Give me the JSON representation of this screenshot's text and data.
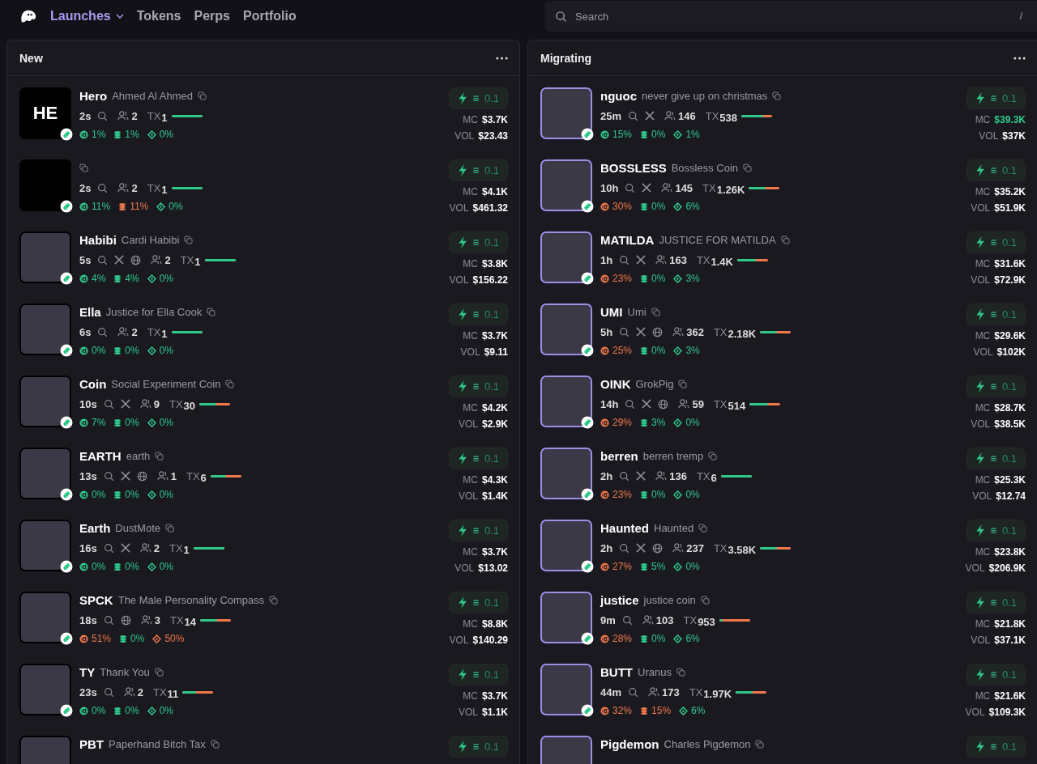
{
  "nav": {
    "items": [
      {
        "label": "Launches",
        "selected": true,
        "dropdown": true
      },
      {
        "label": "Tokens",
        "selected": false,
        "dropdown": false
      },
      {
        "label": "Perps",
        "selected": false,
        "dropdown": false
      },
      {
        "label": "Portfolio",
        "selected": false,
        "dropdown": false
      }
    ]
  },
  "search": {
    "placeholder": "Search",
    "shortcut": "/"
  },
  "columns": [
    {
      "title": "New",
      "tokens": [
        {
          "ticker": "Hero",
          "name": "Ahmed Al Ahmed",
          "avatar_text": "HE",
          "ring": false,
          "partial": false,
          "age": "2s",
          "links": [
            {
              "kind": "search"
            }
          ],
          "holders": "2",
          "tx_label": "TX",
          "tx": "1",
          "level": 1,
          "top10": {
            "value": "1%",
            "warn": false
          },
          "dev": {
            "value": "1%",
            "warn": false
          },
          "snipers": {
            "value": "0%",
            "warn": false
          },
          "mc_label": "MC",
          "mc": "$3.7K",
          "mc_up": false,
          "vol_label": "VOL",
          "vol": "$23.43",
          "quick_buy": "0.1"
        },
        {
          "avatar_blank": true,
          "ring": false,
          "partial": false,
          "age": "2s",
          "links": [
            {
              "kind": "search"
            }
          ],
          "holders": "2",
          "tx_label": "TX",
          "tx": "1",
          "level": 1,
          "top10": {
            "value": "11%",
            "warn": false
          },
          "dev": {
            "value": "11%",
            "warn": true
          },
          "snipers": {
            "value": "0%",
            "warn": false
          },
          "mc_label": "MC",
          "mc": "$4.1K",
          "mc_up": false,
          "vol_label": "VOL",
          "vol": "$461.32",
          "quick_buy": "0.1"
        },
        {
          "ticker": "Habibi",
          "name": "Cardi Habibi",
          "ring": false,
          "partial": false,
          "age": "5s",
          "links": [
            {
              "kind": "search"
            },
            {
              "kind": "x"
            },
            {
              "kind": "web"
            }
          ],
          "holders": "2",
          "tx_label": "TX",
          "tx": "1",
          "level": 1,
          "top10": {
            "value": "4%",
            "warn": false
          },
          "dev": {
            "value": "4%",
            "warn": false
          },
          "snipers": {
            "value": "0%",
            "warn": false
          },
          "mc_label": "MC",
          "mc": "$3.8K",
          "mc_up": false,
          "vol_label": "VOL",
          "vol": "$156.22",
          "quick_buy": "0.1"
        },
        {
          "ticker": "Ella",
          "name": "Justice for Ella Cook",
          "ring": false,
          "partial": false,
          "age": "6s",
          "links": [
            {
              "kind": "search"
            }
          ],
          "holders": "2",
          "tx_label": "TX",
          "tx": "1",
          "level": 1,
          "top10": {
            "value": "0%",
            "warn": false
          },
          "dev": {
            "value": "0%",
            "warn": false
          },
          "snipers": {
            "value": "0%",
            "warn": false
          },
          "mc_label": "MC",
          "mc": "$3.7K",
          "mc_up": false,
          "vol_label": "VOL",
          "vol": "$9.11",
          "quick_buy": "0.1"
        },
        {
          "ticker": "Coin",
          "name": "Social Experiment Coin",
          "ring": false,
          "partial": false,
          "age": "10s",
          "links": [
            {
              "kind": "search"
            },
            {
              "kind": "x"
            }
          ],
          "holders": "9",
          "tx_label": "TX",
          "tx": "30",
          "level": 0.55,
          "top10": {
            "value": "7%",
            "warn": false
          },
          "dev": {
            "value": "0%",
            "warn": false
          },
          "snipers": {
            "value": "0%",
            "warn": false
          },
          "mc_label": "MC",
          "mc": "$4.2K",
          "mc_up": false,
          "vol_label": "VOL",
          "vol": "$2.9K",
          "quick_buy": "0.1"
        },
        {
          "ticker": "EARTH",
          "name": "earth",
          "ring": false,
          "partial": false,
          "age": "13s",
          "links": [
            {
              "kind": "search"
            },
            {
              "kind": "x"
            },
            {
              "kind": "web"
            }
          ],
          "holders": "1",
          "tx_label": "TX",
          "tx": "6",
          "level": 0.5,
          "top10": {
            "value": "0%",
            "warn": false
          },
          "dev": {
            "value": "0%",
            "warn": false
          },
          "snipers": {
            "value": "0%",
            "warn": false
          },
          "mc_label": "MC",
          "mc": "$4.3K",
          "mc_up": false,
          "vol_label": "VOL",
          "vol": "$1.4K",
          "quick_buy": "0.1"
        },
        {
          "ticker": "Earth",
          "name": "DustMote",
          "ring": false,
          "partial": false,
          "age": "16s",
          "links": [
            {
              "kind": "search"
            },
            {
              "kind": "x"
            }
          ],
          "holders": "2",
          "tx_label": "TX",
          "tx": "1",
          "level": 1,
          "top10": {
            "value": "0%",
            "warn": false
          },
          "dev": {
            "value": "0%",
            "warn": false
          },
          "snipers": {
            "value": "0%",
            "warn": false
          },
          "mc_label": "MC",
          "mc": "$3.7K",
          "mc_up": false,
          "vol_label": "VOL",
          "vol": "$13.02",
          "quick_buy": "0.1"
        },
        {
          "ticker": "SPCK",
          "name": "The Male Personality Compass",
          "ring": false,
          "partial": false,
          "age": "18s",
          "links": [
            {
              "kind": "search"
            },
            {
              "kind": "web"
            }
          ],
          "holders": "3",
          "tx_label": "TX",
          "tx": "14",
          "level": 0.55,
          "top10": {
            "value": "51%",
            "warn": true
          },
          "dev": {
            "value": "0%",
            "warn": false
          },
          "snipers": {
            "value": "50%",
            "warn": true
          },
          "mc_label": "MC",
          "mc": "$8.8K",
          "mc_up": false,
          "vol_label": "VOL",
          "vol": "$140.29",
          "quick_buy": "0.1"
        },
        {
          "ticker": "TY",
          "name": "Thank You",
          "ring": false,
          "partial": false,
          "age": "23s",
          "links": [
            {
              "kind": "search"
            }
          ],
          "holders": "2",
          "tx_label": "TX",
          "tx": "11",
          "level": 0.45,
          "top10": {
            "value": "0%",
            "warn": false
          },
          "dev": {
            "value": "0%",
            "warn": false
          },
          "snipers": {
            "value": "0%",
            "warn": false
          },
          "mc_label": "MC",
          "mc": "$3.7K",
          "mc_up": false,
          "vol_label": "VOL",
          "vol": "$1.1K",
          "quick_buy": "0.1"
        },
        {
          "ticker": "PBT",
          "name": "Paperhand Bitch Tax",
          "ring": false,
          "partial": true,
          "quick_buy": "0.1"
        }
      ]
    },
    {
      "title": "Migrating",
      "tokens": [
        {
          "ticker": "nguoc",
          "name": "never give up on christmas",
          "ring": true,
          "partial": false,
          "age": "25m",
          "links": [
            {
              "kind": "search"
            },
            {
              "kind": "x"
            }
          ],
          "holders": "146",
          "tx_label": "TX",
          "tx": "538",
          "level": 0.7,
          "top10": {
            "value": "15%",
            "warn": false
          },
          "dev": {
            "value": "0%",
            "warn": false
          },
          "snipers": {
            "value": "1%",
            "warn": false
          },
          "mc_label": "MC",
          "mc": "$39.3K",
          "mc_up": true,
          "vol_label": "VOL",
          "vol": "$37K",
          "quick_buy": "0.1"
        },
        {
          "ticker": "BOSSLESS",
          "name": "Bossless Coin",
          "ring": true,
          "partial": false,
          "age": "10h",
          "links": [
            {
              "kind": "search"
            },
            {
              "kind": "x"
            }
          ],
          "holders": "145",
          "tx_label": "TX",
          "tx": "1.26K",
          "level": 0.55,
          "top10": {
            "value": "30%",
            "warn": true
          },
          "dev": {
            "value": "0%",
            "warn": false
          },
          "snipers": {
            "value": "6%",
            "warn": false
          },
          "mc_label": "MC",
          "mc": "$35.2K",
          "mc_up": false,
          "vol_label": "VOL",
          "vol": "$51.9K",
          "quick_buy": "0.1"
        },
        {
          "ticker": "MATILDA",
          "name": "JUSTICE FOR MATILDA",
          "ring": true,
          "partial": false,
          "age": "1h",
          "links": [
            {
              "kind": "search"
            },
            {
              "kind": "x"
            }
          ],
          "holders": "163",
          "tx_label": "TX",
          "tx": "1.4K",
          "level": 0.6,
          "top10": {
            "value": "23%",
            "warn": true
          },
          "dev": {
            "value": "0%",
            "warn": false
          },
          "snipers": {
            "value": "3%",
            "warn": false
          },
          "mc_label": "MC",
          "mc": "$31.6K",
          "mc_up": false,
          "vol_label": "VOL",
          "vol": "$72.9K",
          "quick_buy": "0.1"
        },
        {
          "ticker": "UMI",
          "name": "Umi",
          "ring": true,
          "partial": false,
          "age": "5h",
          "links": [
            {
              "kind": "search"
            },
            {
              "kind": "x"
            },
            {
              "kind": "web"
            }
          ],
          "holders": "362",
          "tx_label": "TX",
          "tx": "2.18K",
          "level": 0.55,
          "top10": {
            "value": "25%",
            "warn": true
          },
          "dev": {
            "value": "0%",
            "warn": false
          },
          "snipers": {
            "value": "3%",
            "warn": false
          },
          "mc_label": "MC",
          "mc": "$29.6K",
          "mc_up": false,
          "vol_label": "VOL",
          "vol": "$102K",
          "quick_buy": "0.1"
        },
        {
          "ticker": "OINK",
          "name": "GrokPig",
          "ring": true,
          "partial": false,
          "age": "14h",
          "links": [
            {
              "kind": "search"
            },
            {
              "kind": "x"
            },
            {
              "kind": "web"
            }
          ],
          "holders": "59",
          "tx_label": "TX",
          "tx": "514",
          "level": 0.6,
          "top10": {
            "value": "29%",
            "warn": true
          },
          "dev": {
            "value": "3%",
            "warn": false
          },
          "snipers": {
            "value": "0%",
            "warn": false
          },
          "mc_label": "MC",
          "mc": "$28.7K",
          "mc_up": false,
          "vol_label": "VOL",
          "vol": "$38.5K",
          "quick_buy": "0.1"
        },
        {
          "ticker": "berren",
          "name": "berren tremp",
          "ring": true,
          "partial": false,
          "age": "2h",
          "links": [
            {
              "kind": "search"
            },
            {
              "kind": "x"
            }
          ],
          "holders": "136",
          "tx_label": "TX",
          "tx": "6",
          "level": 1,
          "top10": {
            "value": "23%",
            "warn": true
          },
          "dev": {
            "value": "0%",
            "warn": false
          },
          "snipers": {
            "value": "0%",
            "warn": false
          },
          "mc_label": "MC",
          "mc": "$25.3K",
          "mc_up": false,
          "vol_label": "VOL",
          "vol": "$12.74",
          "quick_buy": "0.1"
        },
        {
          "ticker": "Haunted",
          "name": "Haunted",
          "ring": true,
          "partial": false,
          "age": "2h",
          "links": [
            {
              "kind": "search"
            },
            {
              "kind": "x"
            },
            {
              "kind": "web"
            }
          ],
          "holders": "237",
          "tx_label": "TX",
          "tx": "3.58K",
          "level": 0.55,
          "top10": {
            "value": "27%",
            "warn": true
          },
          "dev": {
            "value": "5%",
            "warn": false
          },
          "snipers": {
            "value": "0%",
            "warn": false
          },
          "mc_label": "MC",
          "mc": "$23.8K",
          "mc_up": false,
          "vol_label": "VOL",
          "vol": "$206.9K",
          "quick_buy": "0.1"
        },
        {
          "ticker": "justice",
          "name": "justice coin",
          "ring": true,
          "partial": false,
          "age": "9m",
          "links": [
            {
              "kind": "search"
            }
          ],
          "holders": "103",
          "tx_label": "TX",
          "tx": "953",
          "level": 0.1,
          "top10": {
            "value": "28%",
            "warn": true
          },
          "dev": {
            "value": "0%",
            "warn": false
          },
          "snipers": {
            "value": "6%",
            "warn": false
          },
          "mc_label": "MC",
          "mc": "$21.8K",
          "mc_up": false,
          "vol_label": "VOL",
          "vol": "$37.1K",
          "quick_buy": "0.1"
        },
        {
          "ticker": "BUTT",
          "name": "Uranus",
          "ring": true,
          "partial": false,
          "age": "44m",
          "links": [
            {
              "kind": "search"
            }
          ],
          "holders": "173",
          "tx_label": "TX",
          "tx": "1.97K",
          "level": 0.55,
          "top10": {
            "value": "32%",
            "warn": true
          },
          "dev": {
            "value": "15%",
            "warn": true
          },
          "snipers": {
            "value": "6%",
            "warn": false
          },
          "mc_label": "MC",
          "mc": "$21.6K",
          "mc_up": false,
          "vol_label": "VOL",
          "vol": "$109.3K",
          "quick_buy": "0.1"
        },
        {
          "ticker": "Pigdemon",
          "name": "Charles Pigdemon",
          "ring": true,
          "partial": true,
          "quick_buy": "0.1"
        }
      ]
    }
  ]
}
